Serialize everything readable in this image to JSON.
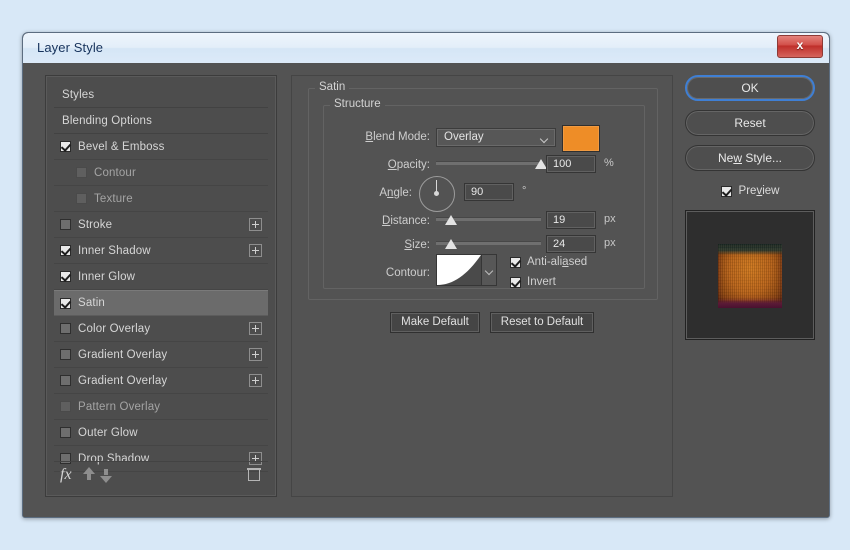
{
  "window": {
    "title": "Layer Style",
    "close_label": "x"
  },
  "sidebar": {
    "items": [
      {
        "label": "Styles",
        "kind": "header",
        "checked": null,
        "indent": false,
        "plus": false,
        "selected": false,
        "dim": false
      },
      {
        "label": "Blending Options",
        "kind": "header",
        "checked": null,
        "indent": false,
        "plus": false,
        "selected": false,
        "dim": false
      },
      {
        "label": "Bevel & Emboss",
        "kind": "effect",
        "checked": true,
        "indent": false,
        "plus": false,
        "selected": false,
        "dim": false
      },
      {
        "label": "Contour",
        "kind": "sub",
        "checked": false,
        "indent": true,
        "plus": false,
        "selected": false,
        "dim": true
      },
      {
        "label": "Texture",
        "kind": "sub",
        "checked": false,
        "indent": true,
        "plus": false,
        "selected": false,
        "dim": true
      },
      {
        "label": "Stroke",
        "kind": "effect",
        "checked": false,
        "indent": false,
        "plus": true,
        "selected": false,
        "dim": false
      },
      {
        "label": "Inner Shadow",
        "kind": "effect",
        "checked": true,
        "indent": false,
        "plus": true,
        "selected": false,
        "dim": false
      },
      {
        "label": "Inner Glow",
        "kind": "effect",
        "checked": true,
        "indent": false,
        "plus": false,
        "selected": false,
        "dim": false
      },
      {
        "label": "Satin",
        "kind": "effect",
        "checked": true,
        "indent": false,
        "plus": false,
        "selected": true,
        "dim": false
      },
      {
        "label": "Color Overlay",
        "kind": "effect",
        "checked": false,
        "indent": false,
        "plus": true,
        "selected": false,
        "dim": false
      },
      {
        "label": "Gradient Overlay",
        "kind": "effect",
        "checked": false,
        "indent": false,
        "plus": true,
        "selected": false,
        "dim": false
      },
      {
        "label": "Gradient Overlay",
        "kind": "effect",
        "checked": false,
        "indent": false,
        "plus": true,
        "selected": false,
        "dim": false
      },
      {
        "label": "Pattern Overlay",
        "kind": "effect",
        "checked": false,
        "indent": false,
        "plus": false,
        "selected": false,
        "dim": true
      },
      {
        "label": "Outer Glow",
        "kind": "effect",
        "checked": false,
        "indent": false,
        "plus": false,
        "selected": false,
        "dim": false
      },
      {
        "label": "Drop Shadow",
        "kind": "effect",
        "checked": false,
        "indent": false,
        "plus": true,
        "selected": false,
        "dim": false
      }
    ],
    "footer": {
      "fx_label": "fx",
      "move_up_icon": "arrow-up-icon",
      "move_down_icon": "arrow-down-icon",
      "delete_icon": "trash-icon"
    }
  },
  "panel": {
    "group_title": "Satin",
    "section_title": "Structure",
    "blend_mode": {
      "label": "Blend Mode:",
      "value": "Overlay",
      "color_swatch": "#ee8d27"
    },
    "opacity": {
      "label": "Opacity:",
      "value": "100",
      "unit": "%",
      "slider_percent": 100
    },
    "angle": {
      "label": "Angle:",
      "value": "90",
      "unit": "°",
      "dial_degrees": 90
    },
    "distance": {
      "label": "Distance:",
      "value": "19",
      "unit": "px",
      "slider_percent": 14
    },
    "size": {
      "label": "Size:",
      "value": "24",
      "unit": "px",
      "slider_percent": 14
    },
    "contour": {
      "label": "Contour:",
      "anti_aliased_label": "Anti-aliased",
      "anti_aliased_checked": true,
      "invert_label": "Invert",
      "invert_checked": true
    },
    "make_default_label": "Make Default",
    "reset_to_default_label": "Reset to Default"
  },
  "actions": {
    "ok_label": "OK",
    "reset_label": "Reset",
    "new_style_label": "New Style...",
    "preview_label": "Preview",
    "preview_checked": true
  }
}
